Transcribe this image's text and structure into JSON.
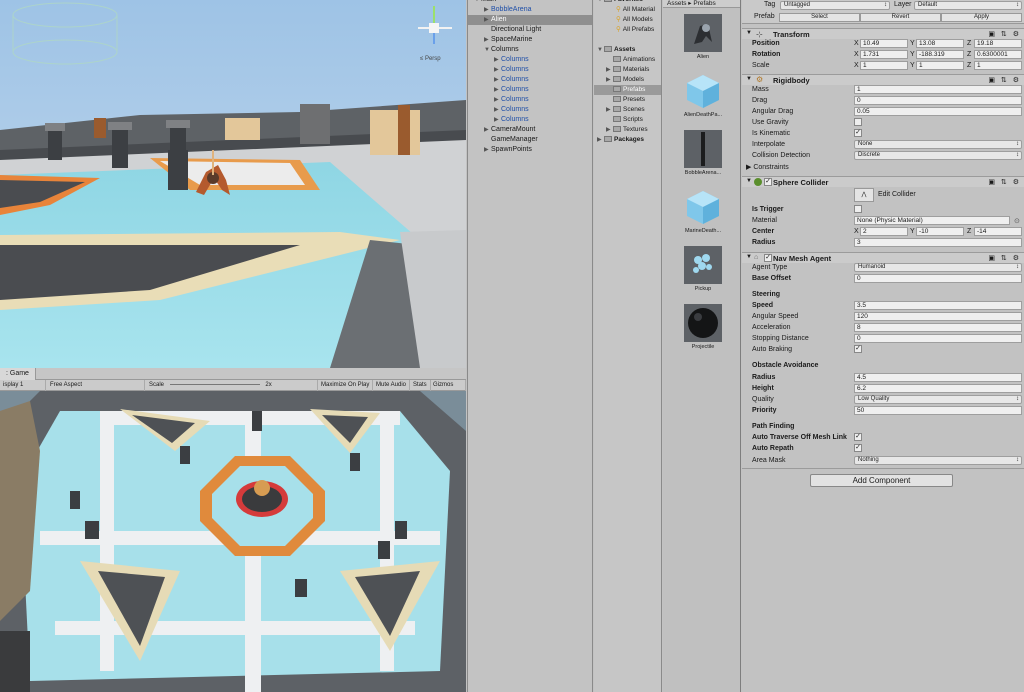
{
  "game": {
    "tab_label": ": Game",
    "display": "isplay 1",
    "aspect": "Free Aspect",
    "scale_label": "Scale",
    "scale_value": "2x",
    "maximize": "Maximize On Play",
    "mute": "Mute Audio",
    "stats": "Stats",
    "gizmos": "Gizmos"
  },
  "scene": {
    "persp_label": "≤ Persp"
  },
  "hierarchy": {
    "items": [
      {
        "label": "Main",
        "indent": 0,
        "arrow": "▼"
      },
      {
        "label": "BobbleArena",
        "indent": 1,
        "arrow": "▶",
        "blue": true
      },
      {
        "label": "Alien",
        "indent": 1,
        "arrow": "▶",
        "selected": true
      },
      {
        "label": "Directional Light",
        "indent": 1,
        "arrow": ""
      },
      {
        "label": "SpaceMarine",
        "indent": 1,
        "arrow": "▶"
      },
      {
        "label": "Columns",
        "indent": 1,
        "arrow": "▼"
      },
      {
        "label": "Columns",
        "indent": 2,
        "arrow": "▶",
        "blue": true
      },
      {
        "label": "Columns",
        "indent": 2,
        "arrow": "▶",
        "blue": true
      },
      {
        "label": "Columns",
        "indent": 2,
        "arrow": "▶",
        "blue": true
      },
      {
        "label": "Columns",
        "indent": 2,
        "arrow": "▶",
        "blue": true
      },
      {
        "label": "Columns",
        "indent": 2,
        "arrow": "▶",
        "blue": true
      },
      {
        "label": "Columns",
        "indent": 2,
        "arrow": "▶",
        "blue": true
      },
      {
        "label": "Columns",
        "indent": 2,
        "arrow": "▶",
        "blue": true
      },
      {
        "label": "CameraMount",
        "indent": 1,
        "arrow": "▶"
      },
      {
        "label": "GameManager",
        "indent": 1,
        "arrow": ""
      },
      {
        "label": "SpawnPoints",
        "indent": 1,
        "arrow": "▶"
      }
    ]
  },
  "project": {
    "tree": [
      {
        "label": "Favorites",
        "kind": "head",
        "arrow": "▼"
      },
      {
        "label": "All Material",
        "kind": "fav"
      },
      {
        "label": "All Models",
        "kind": "fav"
      },
      {
        "label": "All Prefabs",
        "kind": "fav"
      },
      {
        "label": "",
        "kind": "blank"
      },
      {
        "label": "Assets",
        "kind": "head",
        "arrow": "▼"
      },
      {
        "label": "Animations",
        "kind": "folder",
        "arrow": ""
      },
      {
        "label": "Materials",
        "kind": "folder",
        "arrow": "▶"
      },
      {
        "label": "Models",
        "kind": "folder",
        "arrow": "▶"
      },
      {
        "label": "Prefabs",
        "kind": "folder",
        "arrow": "",
        "selected": true
      },
      {
        "label": "Presets",
        "kind": "folder",
        "arrow": ""
      },
      {
        "label": "Scenes",
        "kind": "folder",
        "arrow": "▶"
      },
      {
        "label": "Scripts",
        "kind": "folder",
        "arrow": ""
      },
      {
        "label": "Textures",
        "kind": "folder",
        "arrow": "▶"
      },
      {
        "label": "Packages",
        "kind": "head",
        "arrow": "▶"
      }
    ],
    "breadcrumb": "Assets ▸ Prefabs",
    "assets": [
      {
        "label": "Alien",
        "thumb": "alien"
      },
      {
        "label": "AlienDeathPa...",
        "thumb": "cube"
      },
      {
        "label": "BobbleArena...",
        "thumb": "pillar"
      },
      {
        "label": "MarineDeath...",
        "thumb": "cube"
      },
      {
        "label": "Pickup",
        "thumb": "pickup"
      },
      {
        "label": "Projectile",
        "thumb": "sphere"
      }
    ]
  },
  "inspector": {
    "tag_label": "Tag",
    "tag_value": "Untagged",
    "layer_label": "Layer",
    "layer_value": "Default",
    "prefab_label": "Prefab",
    "select": "Select",
    "revert": "Revert",
    "apply": "Apply",
    "transform": {
      "title": "Transform",
      "position_label": "Position",
      "pos_x": "10.49",
      "pos_y": "13.08",
      "pos_z": "19.18",
      "rotation_label": "Rotation",
      "rot_x": "1.731",
      "rot_y": "-188.319",
      "rot_z": "0.6300001",
      "scale_label": "Scale",
      "scl_x": "1",
      "scl_y": "1",
      "scl_z": "1"
    },
    "rigidbody": {
      "title": "Rigidbody",
      "mass_label": "Mass",
      "mass": "1",
      "drag_label": "Drag",
      "drag": "0",
      "angular_drag_label": "Angular Drag",
      "angular_drag": "0.05",
      "use_gravity_label": "Use Gravity",
      "is_kinematic_label": "Is Kinematic",
      "interpolate_label": "Interpolate",
      "interpolate": "None",
      "collision_label": "Collision Detection",
      "collision": "Discrete",
      "constraints_label": "Constraints"
    },
    "sphere": {
      "title": "Sphere Collider",
      "edit_label": "Edit Collider",
      "is_trigger_label": "Is Trigger",
      "material_label": "Material",
      "material": "None (Physic Material)",
      "center_label": "Center",
      "cx": "2",
      "cy": "-10",
      "cz": "-14",
      "radius_label": "Radius",
      "radius": "3"
    },
    "nav": {
      "title": "Nav Mesh Agent",
      "agent_type_label": "Agent Type",
      "agent_type": "Humanoid",
      "base_offset_label": "Base Offset",
      "base_offset": "0",
      "steering_label": "Steering",
      "speed_label": "Speed",
      "speed": "3.5",
      "angular_speed_label": "Angular Speed",
      "angular_speed": "120",
      "accel_label": "Acceleration",
      "accel": "8",
      "stopping_label": "Stopping Distance",
      "stopping": "0",
      "auto_braking_label": "Auto Braking",
      "obstacle_label": "Obstacle Avoidance",
      "radius_label": "Radius",
      "radius": "4.5",
      "height_label": "Height",
      "height": "6.2",
      "quality_label": "Quality",
      "quality": "Low Quality",
      "priority_label": "Priority",
      "priority": "50",
      "pathfinding_label": "Path Finding",
      "auto_traverse_label": "Auto Traverse Off Mesh Link",
      "auto_repath_label": "Auto Repath",
      "area_mask_label": "Area Mask",
      "area_mask": "Nothing"
    },
    "add_component": "Add Component"
  },
  "axis_labels": {
    "x": "X",
    "y": "Y",
    "z": "Z"
  },
  "check_mark": "✓"
}
